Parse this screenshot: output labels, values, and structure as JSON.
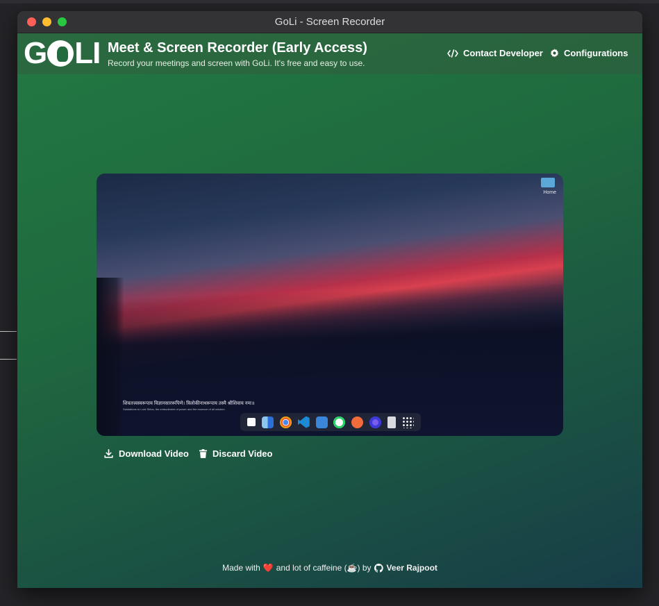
{
  "window": {
    "title": "GoLi - Screen Recorder"
  },
  "header": {
    "logo_text_left": "G",
    "logo_text_right": "LI",
    "title": "Meet & Screen Recorder (Early Access)",
    "subtitle": "Record your meetings and screen with GoLi. It's free and easy to use.",
    "nav": {
      "contact_label": "Contact Developer",
      "contact_icon": "code-icon",
      "config_label": "Configurations",
      "config_icon": "gear-icon"
    }
  },
  "preview": {
    "desktop_folder_label": "Home",
    "wallpaper_text": "शिवतत्त्वस्वरूपाय विज्ञानसाररूपिणे। त्रिलोकीनाथरूपाय तस्मै श्रीशिवाय नमः॥",
    "wallpaper_subtext": "Salutations to Lord Shiva, the embodiment of power and the essence of all wisdom",
    "dock_icons": [
      "finder-icon",
      "finder-face-icon",
      "chrome-icon",
      "vscode-icon",
      "preview-icon",
      "whatsapp-icon",
      "safari-icon",
      "arc-icon",
      "trash-icon",
      "launchpad-icon"
    ]
  },
  "actions": {
    "download_label": "Download Video",
    "discard_label": "Discard Video"
  },
  "footer": {
    "made_with": "Made with",
    "heart": "❤️",
    "middle": "and lot of caffeine (☕) by",
    "author": "Veer Rajpoot"
  },
  "colors": {
    "accent_green": "#227a42",
    "close": "#fe5f57",
    "minimize": "#febc2e",
    "maximize": "#28c840"
  }
}
